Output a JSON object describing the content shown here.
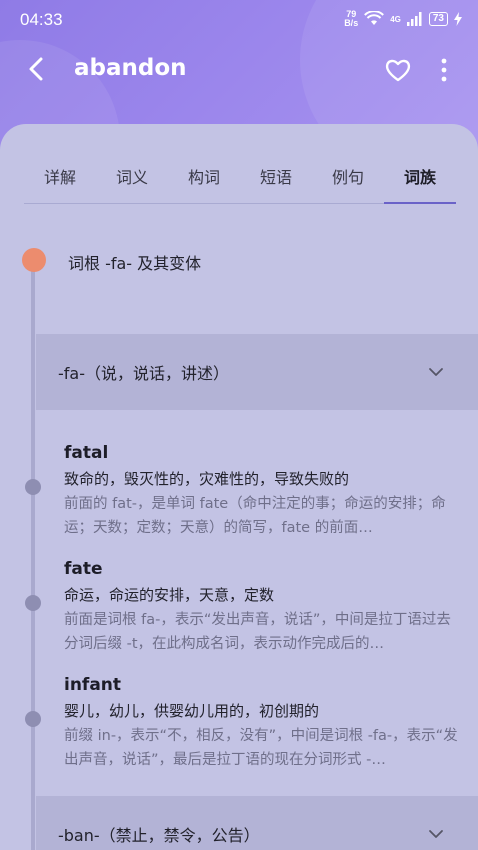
{
  "status_bar": {
    "time": "04:33",
    "net_speed_value": "79",
    "net_speed_unit": "B/s",
    "network_type": "4G",
    "battery": "73"
  },
  "app_bar": {
    "title": "abandon"
  },
  "tabs": [
    {
      "label": "详解"
    },
    {
      "label": "词义"
    },
    {
      "label": "构词"
    },
    {
      "label": "短语"
    },
    {
      "label": "例句"
    },
    {
      "label": "词族",
      "active": true
    }
  ],
  "root": {
    "label": "词根 -fa- 及其变体",
    "dot_color": "#ec8c6e"
  },
  "groups": [
    {
      "label": "-fa-（说，说话，讲述）",
      "expanded": true
    },
    {
      "label": "-ban-（禁止，禁令，公告）",
      "expanded": false
    }
  ],
  "entries": [
    {
      "word": "fatal",
      "meaning": "致命的，毁灭性的，灾难性的，导致失败的",
      "desc": "前面的 fat-，是单词 fate（命中注定的事；命运的安排；命运；天数；定数；天意）的简写，fate 的前面…"
    },
    {
      "word": "fate",
      "meaning": "命运，命运的安排，天意，定数",
      "desc": "前面是词根 fa-，表示“发出声音，说话”，中间是拉丁语过去分词后缀 -t，在此构成名词，表示动作完成后的…"
    },
    {
      "word": "infant",
      "meaning": "婴儿，幼儿，供婴幼儿用的，初创期的",
      "desc": "前缀 in-，表示“不，相反，没有”，中间是词根 -fa-，表示“发出声音，说话”，最后是拉丁语的现在分词形式 -…"
    }
  ],
  "colors": {
    "header_bg": "#9481e8",
    "sheet_bg": "#c3c3e4",
    "group_bg": "#b3b3d6",
    "accent": "#6a62c8"
  }
}
